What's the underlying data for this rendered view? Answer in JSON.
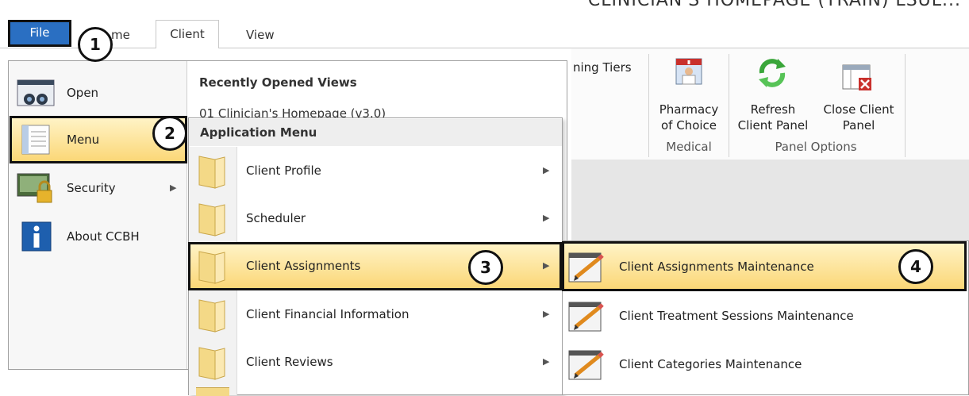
{
  "window": {
    "title": "CLINICIAN'S HOMEPAGE (TRAIN) LSUL..."
  },
  "tabs": {
    "file": "File",
    "home": "me",
    "client": "Client",
    "view": "View"
  },
  "ribbon": {
    "partial_label": "ning Tiers",
    "pharmacy": {
      "line1": "Pharmacy",
      "line2": "of Choice"
    },
    "refresh": {
      "line1": "Refresh",
      "line2": "Client Panel"
    },
    "close": {
      "line1": "Close Client",
      "line2": "Panel"
    },
    "groups": {
      "medical": "Medical",
      "panel_options": "Panel Options"
    }
  },
  "file_menu": {
    "items": [
      {
        "label": "Open",
        "icon": "binoculars-icon"
      },
      {
        "label": "Menu",
        "icon": "document-icon"
      },
      {
        "label": "Security",
        "icon": "lock-icon"
      },
      {
        "label": "About CCBH",
        "icon": "info-icon"
      }
    ],
    "recent_header": "Recently Opened Views",
    "recent_item": "01 Clinician's Homepage (v3.0)"
  },
  "app_menu": {
    "header": "Application Menu",
    "items": [
      {
        "label": "Client Profile"
      },
      {
        "label": "Scheduler"
      },
      {
        "label": "Client Assignments"
      },
      {
        "label": "Client Financial Information"
      },
      {
        "label": "Client Reviews"
      }
    ]
  },
  "sub_menu": {
    "items": [
      {
        "label": "Client Assignments Maintenance"
      },
      {
        "label": "Client Treatment Sessions Maintenance"
      },
      {
        "label": "Client Categories Maintenance"
      }
    ]
  },
  "callouts": [
    "1",
    "2",
    "3",
    "4"
  ],
  "colors": {
    "file_tab": "#2a6fc2",
    "highlight": "#fbd777",
    "callout_border": "#111111"
  }
}
